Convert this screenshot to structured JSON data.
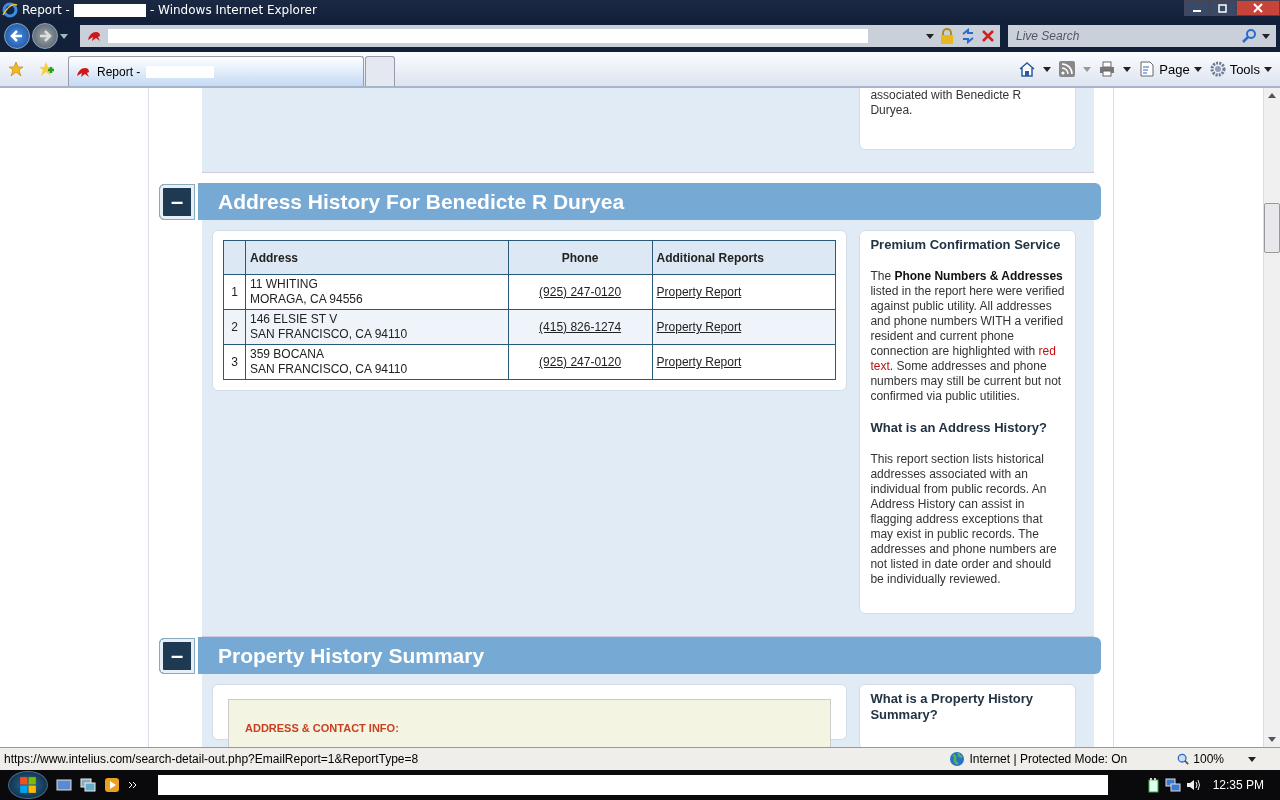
{
  "window": {
    "title_prefix": "Report -",
    "title_suffix": "- Windows Internet Explorer"
  },
  "nav": {
    "search_placeholder": "Live Search"
  },
  "tabs": [
    {
      "kind": "page",
      "label": "Report -",
      "selected": true
    },
    {
      "kind": "new",
      "selected": false
    }
  ],
  "command_bar": {
    "page": "Page",
    "tools": "Tools"
  },
  "top_sidebar_text": "associated with Benedicte R Duryea.",
  "sections": [
    {
      "title": "Address History For Benedicte R Duryea",
      "collapse_label": "–",
      "kind": "table",
      "table": {
        "columns": [
          "Address",
          "Phone",
          "Additional Reports"
        ],
        "rows": [
          {
            "index": "1",
            "address": [
              "11 WHITING",
              "MORAGA, CA 94556"
            ],
            "phone": "(925) 247-0120",
            "report": "Property Report"
          },
          {
            "index": "2",
            "address": [
              "146 ELSIE ST V",
              "SAN FRANCISCO, CA 94110"
            ],
            "phone": "(415) 826-1274",
            "report": "Property Report"
          },
          {
            "index": "3",
            "address": [
              "359 BOCANA",
              "SAN FRANCISCO, CA 94110"
            ],
            "phone": "(925) 247-0120",
            "report": "Property Report"
          }
        ]
      },
      "sidebar": [
        {
          "heading": "Premium Confirmation Service",
          "body": [
            {
              "text": "The ",
              "kind": "plain"
            },
            {
              "text": "Phone Numbers & Addresses",
              "kind": "bold"
            },
            {
              "text": " listed in the report here were verified against public utility. All addresses and phone numbers WITH a verified resident and current phone connection are highlighted with ",
              "kind": "plain"
            },
            {
              "text": "red text",
              "kind": "red"
            },
            {
              "text": ". Some addresses and phone numbers may still be current but not confirmed via public utilities.",
              "kind": "plain"
            }
          ]
        },
        {
          "heading": "What is an Address History?",
          "body": [
            {
              "text": "This report section lists historical addresses associated with an individual from public records. An Address History can assist in flagging address exceptions that may exist in public records. The addresses and phone numbers are not listed in date order and should be individually reviewed.",
              "kind": "plain"
            }
          ]
        }
      ]
    },
    {
      "title": "Property History Summary",
      "collapse_label": "–",
      "kind": "summary",
      "inner_heading": "ADDRESS & CONTACT INFO:",
      "sidebar": [
        {
          "heading": "What is a Property History Summary?"
        }
      ]
    }
  ],
  "status_bar": {
    "url": "https://www.intelius.com/search-detail-out.php?EmailReport=1&ReportType=8",
    "zone": "Internet | Protected Mode: On",
    "zoom": "100%"
  },
  "taskbar": {
    "clock": "12:35 PM"
  }
}
